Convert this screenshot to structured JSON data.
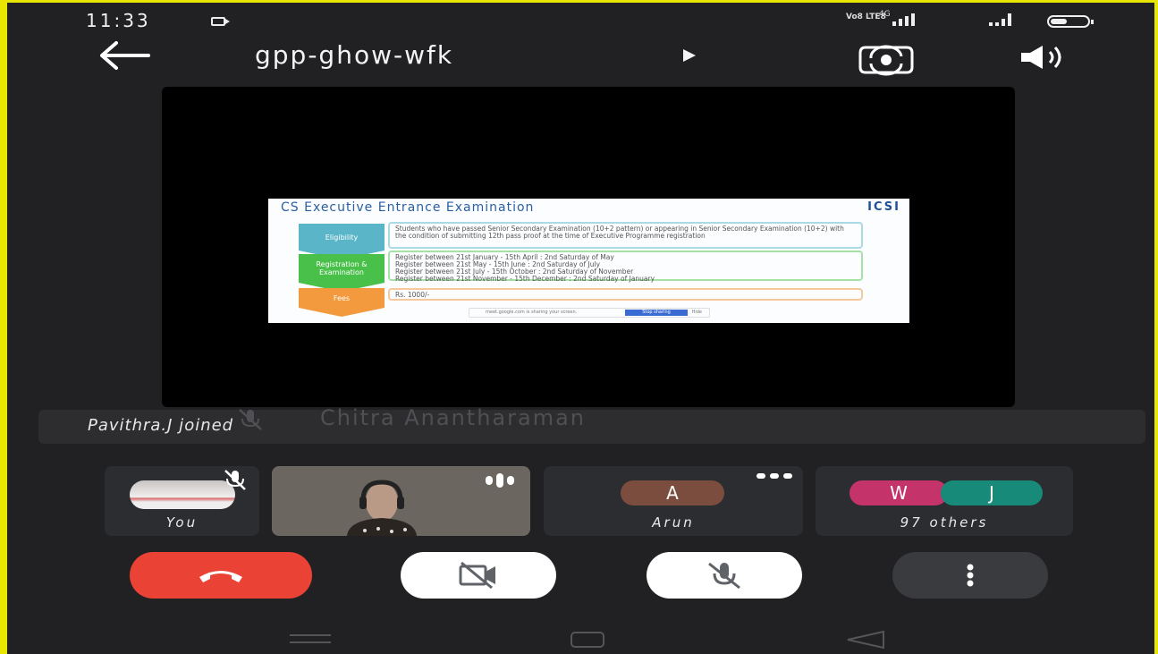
{
  "status_bar": {
    "time": "11:33",
    "network_label": "Vo8 LTE8",
    "network_type": "4G"
  },
  "header": {
    "meeting_code": "gpp-ghow-wfk"
  },
  "presentation": {
    "slide_title": "CS Executive Entrance Examination",
    "slide_logo": "ICSI",
    "steps": [
      {
        "label": "Eligibility",
        "text": "Students who have passed Senior Secondary Examination (10+2 pattern) or appearing in Senior Secondary Examination (10+2) with the condition of submitting 12th pass proof at the time of Executive Programme registration"
      },
      {
        "label": "Registration & Examination",
        "lines": [
          "Register between 21st January - 15th April : 2nd Saturday of May",
          "Register between 21st May - 15th June : 2nd Saturday of July",
          "Register between 21st July - 15th October : 2nd Saturday of November",
          "Register between 21st November - 15th December : 2nd Saturday of January"
        ]
      },
      {
        "label": "Fees",
        "text": "Rs. 1000/-"
      }
    ],
    "share_notice": "meet.google.com is sharing your screen.",
    "stop_sharing": "Stop sharing",
    "hide": "Hide"
  },
  "speaker_name": "Chitra Anantharaman",
  "notification": "Pavithra.J joined",
  "participants": {
    "you_label": "You",
    "arun_initial": "A",
    "arun_label": "Arun",
    "others_initials": [
      "W",
      "J"
    ],
    "others_label": "97 others"
  },
  "colors": {
    "end_call": "#ea4335",
    "avatar_a": "#7a4d3e",
    "avatar_w": "#c4336a",
    "avatar_j": "#178a7a",
    "frame": "#e8e600"
  }
}
